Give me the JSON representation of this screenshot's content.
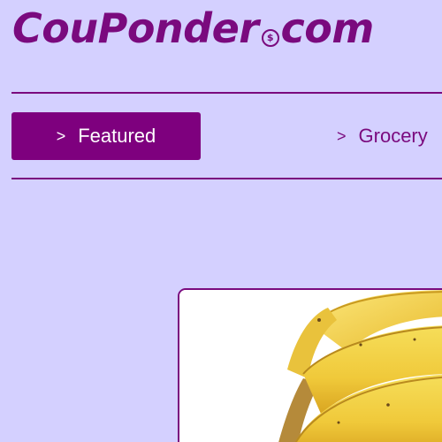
{
  "brand": {
    "name_part1": "CouPonder",
    "coin_symbol": "$",
    "name_part2": "com",
    "color": "#7a0a7e"
  },
  "nav": {
    "items": [
      {
        "chevron": ">",
        "label": "Featured",
        "active": true
      },
      {
        "chevron": ">",
        "label": "Grocery",
        "active": false
      }
    ]
  },
  "colors": {
    "background": "#d4d0ff",
    "accent": "#7e007e",
    "card_background": "#ffffff"
  },
  "product": {
    "image": "bananas-image"
  }
}
